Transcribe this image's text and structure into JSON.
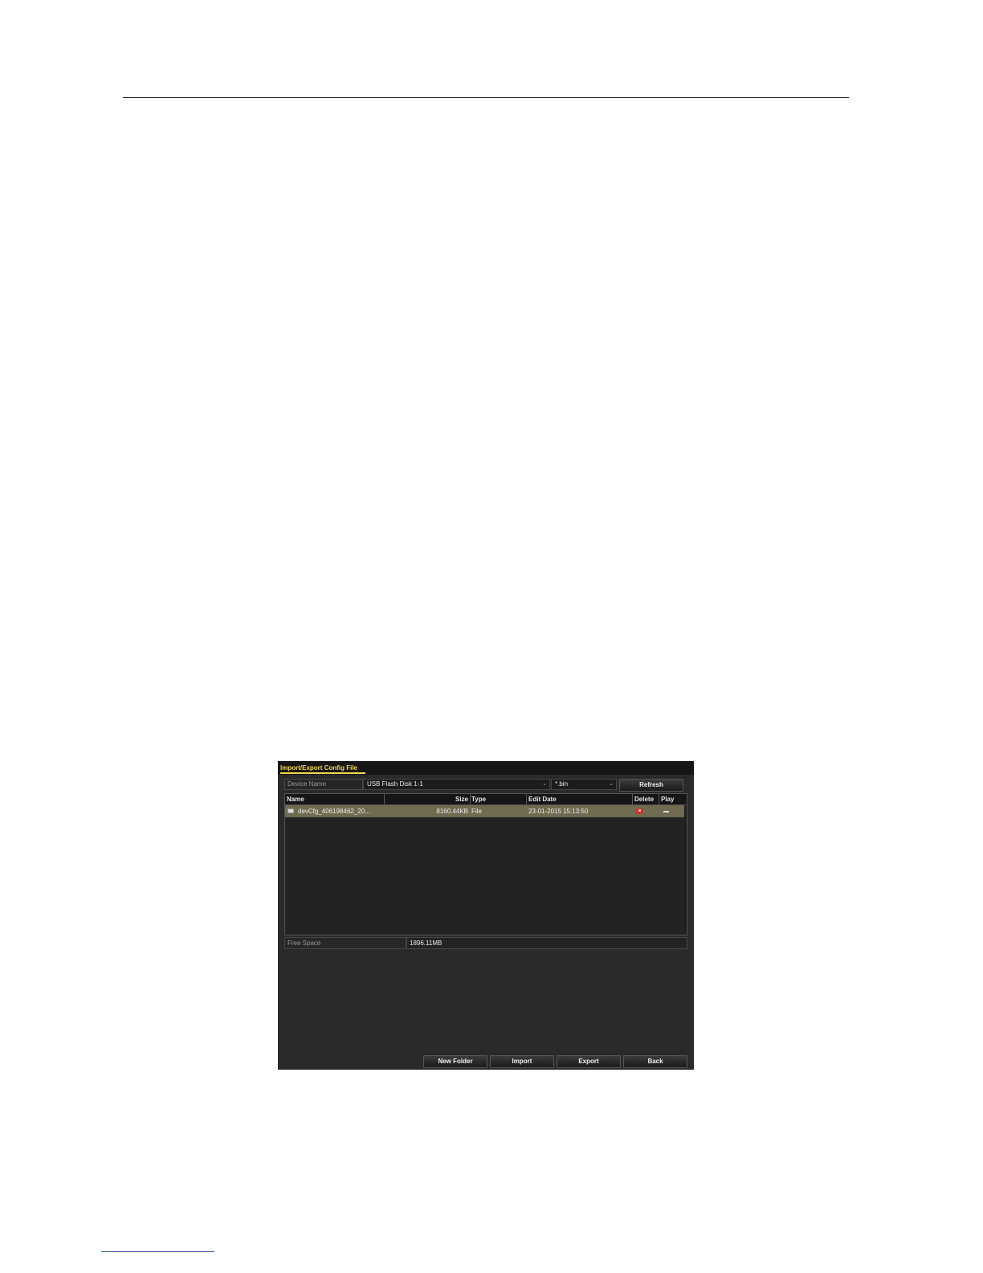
{
  "window": {
    "title": "Import/Export Config File"
  },
  "device": {
    "label": "Device Name",
    "selected": "USB Flash Disk 1-1"
  },
  "filter": {
    "selected": "*.bin"
  },
  "toolbar": {
    "refresh_label": "Refresh"
  },
  "table": {
    "columns": [
      "Name",
      "Size",
      "Type",
      "Edit Date",
      "Delete",
      "Play"
    ],
    "rows": [
      {
        "name": "devCfg_406198462_20...",
        "size": "8160.44KB",
        "type": "File",
        "edit_date": "23-01-2015 15:13:50",
        "delete_icon": "trash-icon",
        "play_icon": "dash-icon"
      }
    ]
  },
  "free_space": {
    "label": "Free Space",
    "value": "1896.11MB"
  },
  "actions": {
    "new_folder": "New Folder",
    "import": "Import",
    "export": "Export",
    "back": "Back"
  },
  "colors": {
    "title_accent": "#f5d64a",
    "selected_row": "#6f6b50",
    "delete_icon": "#c8382c"
  }
}
